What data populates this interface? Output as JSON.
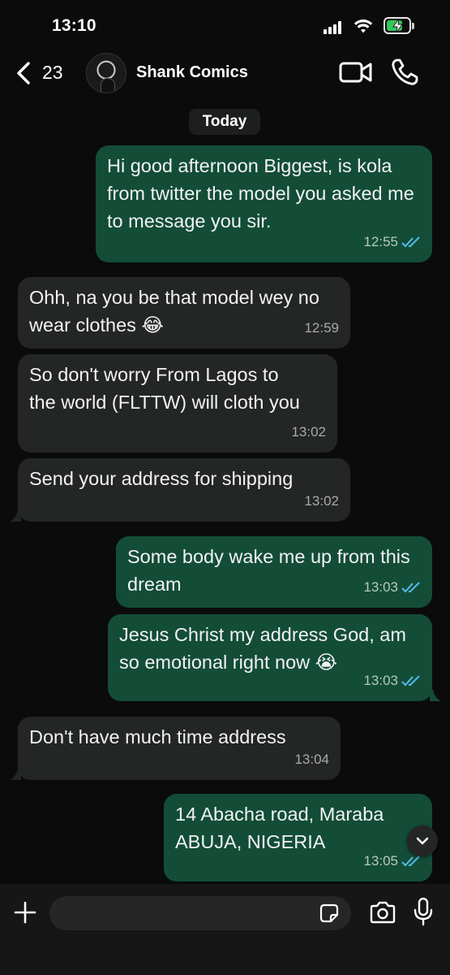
{
  "status": {
    "time": "13:10",
    "battery_color": "#34c759"
  },
  "header": {
    "back_count": "23",
    "contact_name": "Shank Comics"
  },
  "date_chip": "Today",
  "messages": [
    {
      "direction": "outgoing",
      "text": "Hi good afternoon Biggest, is kola from twitter the model you asked me to message you sir.",
      "time": "12:55",
      "read": true
    },
    {
      "direction": "incoming",
      "text": "Ohh, na you be that model wey no wear clothes 😂",
      "time": "12:59"
    },
    {
      "direction": "incoming",
      "text": "So don't worry From Lagos to the world (FLTTW) will cloth you",
      "time": "13:02"
    },
    {
      "direction": "incoming",
      "text": "Send your address for shipping",
      "time": "13:02"
    },
    {
      "direction": "outgoing",
      "text": "Some body wake me up from this dream",
      "time": "13:03",
      "read": true
    },
    {
      "direction": "outgoing",
      "text": "Jesus Christ my address God, am so emotional right now 😭",
      "time": "13:03",
      "read": true
    },
    {
      "direction": "incoming",
      "text": "Don't have much time address",
      "time": "13:04"
    },
    {
      "direction": "outgoing",
      "text": "14 Abacha road, Maraba ABUJA, NIGERIA",
      "time": "13:05",
      "read": true
    }
  ],
  "composer": {
    "placeholder": ""
  },
  "colors": {
    "background": "#0b0b0b",
    "incoming_bubble": "#242626",
    "outgoing_bubble": "#134d37",
    "read_ticks": "#53bdeb"
  },
  "icons": [
    "back-chevron-icon",
    "video-call-icon",
    "phone-icon",
    "plus-icon",
    "sticker-icon",
    "camera-icon",
    "mic-icon",
    "chevron-down-icon"
  ]
}
